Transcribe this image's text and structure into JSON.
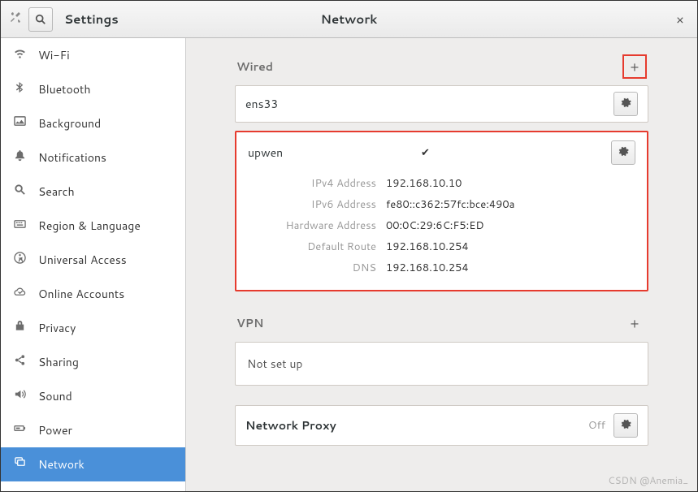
{
  "header": {
    "settings_label": "Settings",
    "page_title": "Network"
  },
  "sidebar": {
    "items": [
      {
        "label": "Wi-Fi"
      },
      {
        "label": "Bluetooth"
      },
      {
        "label": "Background"
      },
      {
        "label": "Notifications"
      },
      {
        "label": "Search"
      },
      {
        "label": "Region & Language"
      },
      {
        "label": "Universal Access"
      },
      {
        "label": "Online Accounts"
      },
      {
        "label": "Privacy"
      },
      {
        "label": "Sharing"
      },
      {
        "label": "Sound"
      },
      {
        "label": "Power"
      },
      {
        "label": "Network"
      }
    ]
  },
  "wired": {
    "title": "Wired",
    "connections": [
      {
        "name": "ens33"
      },
      {
        "name": "upwen",
        "active": true,
        "details": {
          "ipv4_label": "IPv4 Address",
          "ipv4": "192.168.10.10",
          "ipv6_label": "IPv6 Address",
          "ipv6": "fe80::c362:57fc:bce:490a",
          "hw_label": "Hardware Address",
          "hw": "00:0C:29:6C:F5:ED",
          "route_label": "Default Route",
          "route": "192.168.10.254",
          "dns_label": "DNS",
          "dns": "192.168.10.254"
        }
      }
    ]
  },
  "vpn": {
    "title": "VPN",
    "placeholder": "Not set up"
  },
  "proxy": {
    "label": "Network Proxy",
    "status": "Off"
  },
  "watermark": "CSDN @Anemia_"
}
